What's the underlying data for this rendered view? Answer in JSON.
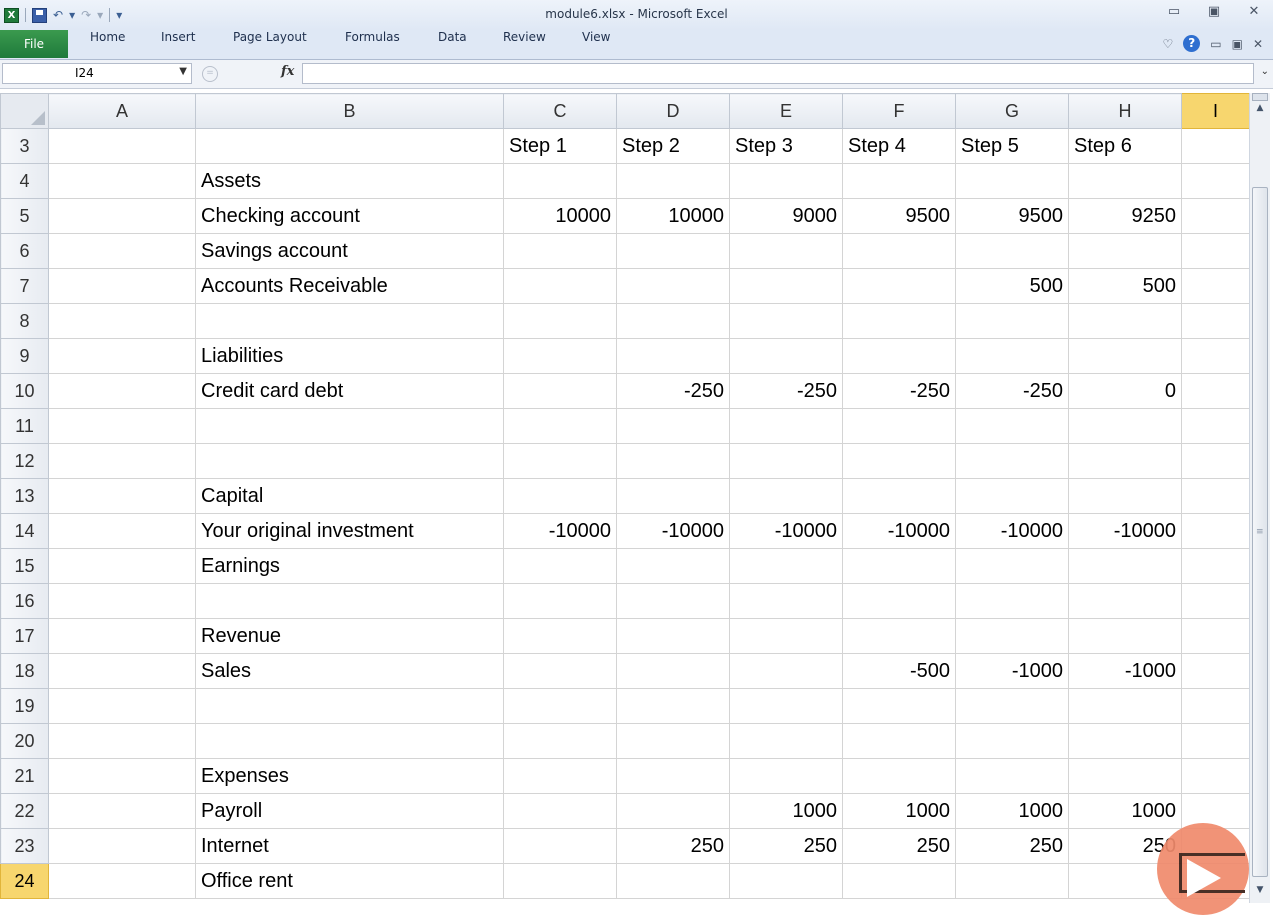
{
  "window": {
    "title": "module6.xlsx - Microsoft Excel",
    "qat_undo": "↶",
    "qat_redo": "↷",
    "qat_customize": "▾"
  },
  "ribbon": {
    "file_label": "File",
    "tabs": [
      "Home",
      "Insert",
      "Page Layout",
      "Formulas",
      "Data",
      "Review",
      "View"
    ]
  },
  "formula_bar": {
    "name_box": "I24",
    "formula": ""
  },
  "grid": {
    "columns": [
      "A",
      "B",
      "C",
      "D",
      "E",
      "F",
      "G",
      "H",
      "I"
    ],
    "active_column": "I",
    "active_row": "24",
    "rows": [
      {
        "row": "3",
        "cells": [
          "",
          "",
          "Step 1",
          "Step 2",
          "Step 3",
          "Step 4",
          "Step 5",
          "Step 6",
          ""
        ]
      },
      {
        "row": "4",
        "cells": [
          "",
          "Assets",
          "",
          "",
          "",
          "",
          "",
          "",
          ""
        ]
      },
      {
        "row": "5",
        "cells": [
          "",
          "Checking account",
          "10000",
          "10000",
          "9000",
          "9500",
          "9500",
          "9250",
          ""
        ]
      },
      {
        "row": "6",
        "cells": [
          "",
          "Savings account",
          "",
          "",
          "",
          "",
          "",
          "",
          ""
        ]
      },
      {
        "row": "7",
        "cells": [
          "",
          "Accounts Receivable",
          "",
          "",
          "",
          "",
          "500",
          "500",
          ""
        ]
      },
      {
        "row": "8",
        "cells": [
          "",
          "",
          "",
          "",
          "",
          "",
          "",
          "",
          ""
        ]
      },
      {
        "row": "9",
        "cells": [
          "",
          "Liabilities",
          "",
          "",
          "",
          "",
          "",
          "",
          ""
        ]
      },
      {
        "row": "10",
        "cells": [
          "",
          "Credit card debt",
          "",
          "-250",
          "-250",
          "-250",
          "-250",
          "0",
          ""
        ]
      },
      {
        "row": "11",
        "cells": [
          "",
          "",
          "",
          "",
          "",
          "",
          "",
          "",
          ""
        ]
      },
      {
        "row": "12",
        "cells": [
          "",
          "",
          "",
          "",
          "",
          "",
          "",
          "",
          ""
        ]
      },
      {
        "row": "13",
        "cells": [
          "",
          "Capital",
          "",
          "",
          "",
          "",
          "",
          "",
          ""
        ]
      },
      {
        "row": "14",
        "cells": [
          "",
          "Your original investment",
          "-10000",
          "-10000",
          "-10000",
          "-10000",
          "-10000",
          "-10000",
          ""
        ]
      },
      {
        "row": "15",
        "cells": [
          "",
          "Earnings",
          "",
          "",
          "",
          "",
          "",
          "",
          ""
        ]
      },
      {
        "row": "16",
        "cells": [
          "",
          "",
          "",
          "",
          "",
          "",
          "",
          "",
          ""
        ]
      },
      {
        "row": "17",
        "cells": [
          "",
          "Revenue",
          "",
          "",
          "",
          "",
          "",
          "",
          ""
        ]
      },
      {
        "row": "18",
        "cells": [
          "",
          "Sales",
          "",
          "",
          "",
          "-500",
          "-1000",
          "-1000",
          ""
        ]
      },
      {
        "row": "19",
        "cells": [
          "",
          "",
          "",
          "",
          "",
          "",
          "",
          "",
          ""
        ]
      },
      {
        "row": "20",
        "cells": [
          "",
          "",
          "",
          "",
          "",
          "",
          "",
          "",
          ""
        ]
      },
      {
        "row": "21",
        "cells": [
          "",
          "Expenses",
          "",
          "",
          "",
          "",
          "",
          "",
          ""
        ]
      },
      {
        "row": "22",
        "cells": [
          "",
          "Payroll",
          "",
          "",
          "1000",
          "1000",
          "1000",
          "1000",
          ""
        ]
      },
      {
        "row": "23",
        "cells": [
          "",
          "Internet",
          "",
          "250",
          "250",
          "250",
          "250",
          "250",
          ""
        ]
      },
      {
        "row": "24",
        "cells": [
          "",
          "Office rent",
          "",
          "",
          "",
          "",
          "",
          "",
          ""
        ]
      }
    ]
  },
  "colors": {
    "file_tab": "#1f7a3b",
    "active_header": "#f7d66e",
    "play_overlay": "#f08a6c"
  },
  "icons": [
    "excel-icon",
    "save-icon",
    "undo-icon",
    "redo-icon",
    "help-icon",
    "fx-icon",
    "play-icon"
  ]
}
